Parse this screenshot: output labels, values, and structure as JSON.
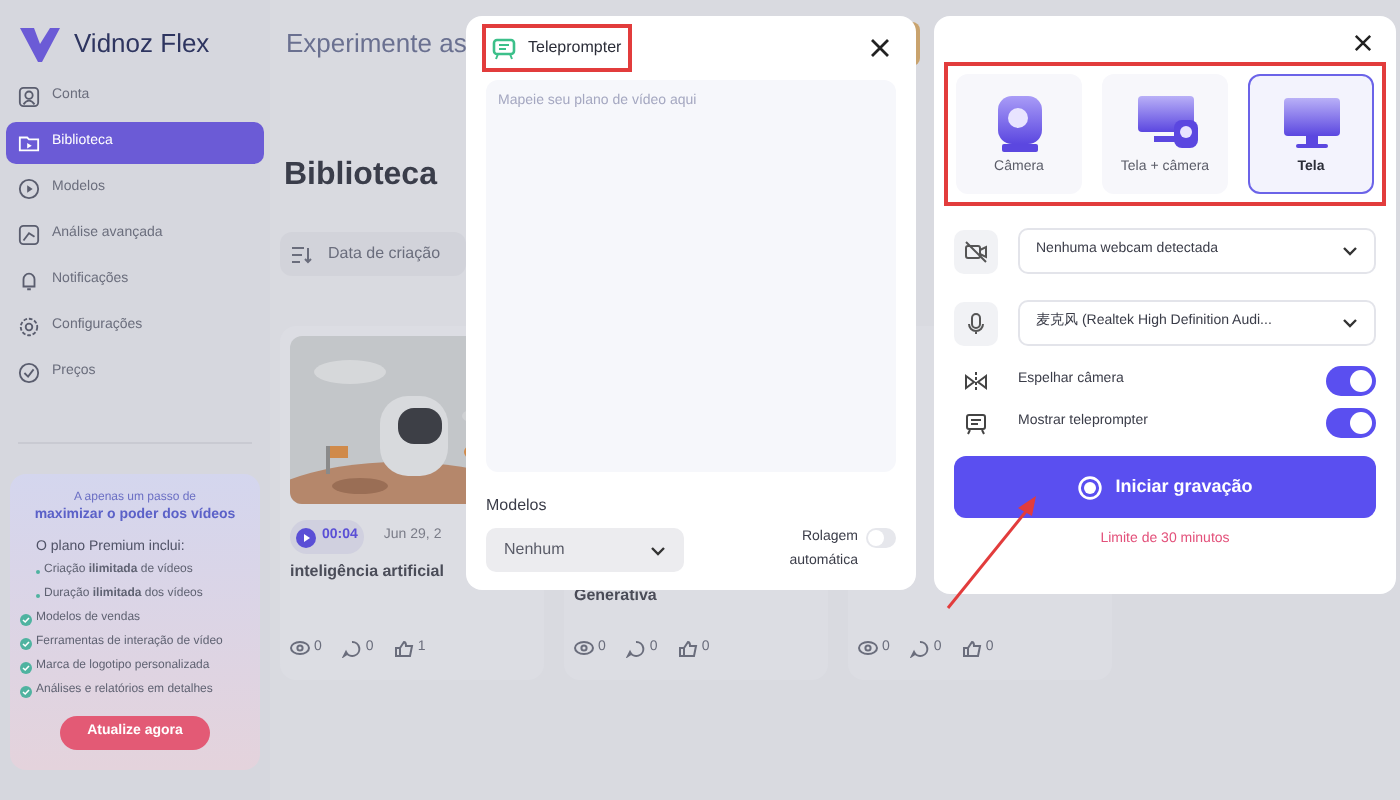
{
  "app": {
    "logo": "Vidnoz Flex",
    "sidebar": [
      {
        "label": "Conta",
        "selected": false
      },
      {
        "label": "Biblioteca",
        "selected": true
      },
      {
        "label": "Modelos",
        "selected": false
      },
      {
        "label": "Análise avançada",
        "selected": false
      },
      {
        "label": "Notificações",
        "selected": false
      },
      {
        "label": "Configurações",
        "selected": false
      },
      {
        "label": "Preços",
        "selected": false
      }
    ],
    "promo": {
      "line_1": "A apenas um passo de",
      "line_2": "maximizar o poder dos vídeos",
      "intro": "O plano Premium inclui:",
      "features": [
        {
          "kind": "dot",
          "text": "Criação **ilimitada** de vídeos"
        },
        {
          "kind": "dot",
          "text": "Duração **ilimitada** dos vídeos"
        },
        {
          "kind": "check",
          "text": "Modelos de vendas"
        },
        {
          "kind": "check",
          "text": "Ferramentas de interação de vídeo"
        },
        {
          "kind": "check",
          "text": "Marca de logotipo personalizada"
        },
        {
          "kind": "check",
          "text": "Análises e relatórios em detalhes"
        }
      ],
      "button": "Atualize agora"
    },
    "header": "Experimente as",
    "page_title": "Biblioteca",
    "sort": "Data de criação",
    "cards": [
      {
        "duration": "00:04",
        "date": "Jun 29, 2",
        "title": "inteligência artificial",
        "views": "0",
        "comments": "0",
        "likes": "1"
      },
      {
        "title": "Generativa",
        "views": "0",
        "comments": "0",
        "likes": "0"
      },
      {
        "views": "0",
        "comments": "0",
        "likes": "0"
      }
    ]
  },
  "teleprompter": {
    "title": "Teleprompter",
    "placeholder": "Mapeie seu plano de vídeo aqui",
    "models_label": "Modelos",
    "models_value": "Nenhum",
    "autoscroll_label": "Rolagem automática",
    "autoscroll_on": false
  },
  "recorder": {
    "modes": [
      {
        "label": "Câmera",
        "kind": "camera",
        "selected": false
      },
      {
        "label": "Tela + câmera",
        "kind": "both",
        "selected": false
      },
      {
        "label": "Tela",
        "kind": "screen",
        "selected": true
      }
    ],
    "webcam": "Nenhuma webcam detectada",
    "microphone": "麦克风 (Realtek High Definition Audi...",
    "toggles": [
      {
        "label": "Espelhar câmera",
        "on": true
      },
      {
        "label": "Mostrar teleprompter",
        "on": true
      }
    ],
    "record_button": "Iniciar gravação",
    "limit": "Limite de 30 minutos"
  }
}
